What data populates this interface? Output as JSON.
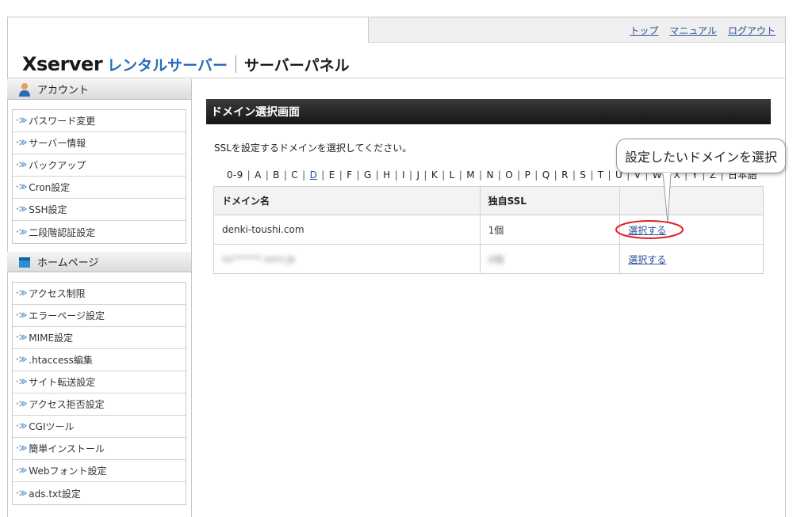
{
  "header": {
    "logo_xserver": "Xserver",
    "logo_rental": "レンタルサーバー",
    "logo_panel": "サーバーパネル",
    "nav": [
      "トップ",
      "マニュアル",
      "ログアウト"
    ]
  },
  "sidebar": {
    "account_title": "アカウント",
    "account_items": [
      "パスワード変更",
      "サーバー情報",
      "バックアップ",
      "Cron設定",
      "SSH設定",
      "二段階認証設定"
    ],
    "homepage_title": "ホームページ",
    "homepage_items": [
      "アクセス制限",
      "エラーページ設定",
      "MIME設定",
      ".htaccess編集",
      "サイト転送設定",
      "アクセス拒否設定",
      "CGIツール",
      "簡単インストール",
      "Webフォント設定",
      "ads.txt設定"
    ]
  },
  "main": {
    "title": "ドメイン選択画面",
    "instruction": "SSLを設定するドメインを選択してください。",
    "alpha_index": [
      "0-9",
      "A",
      "B",
      "C",
      "D",
      "E",
      "F",
      "G",
      "H",
      "I",
      "J",
      "K",
      "L",
      "M",
      "N",
      "O",
      "P",
      "Q",
      "R",
      "S",
      "T",
      "U",
      "V",
      "W",
      "X",
      "Y",
      "Z",
      "日本語"
    ],
    "alpha_current": "D",
    "table": {
      "headers": [
        "ドメイン名",
        "独自SSL",
        ""
      ],
      "rows": [
        {
          "domain": "denki-toushi.com",
          "ssl": "1個",
          "action": "選択する"
        },
        {
          "domain": "xs******.xsrv.jp",
          "ssl": "0個",
          "action": "選択する"
        }
      ]
    }
  },
  "callout": {
    "text": "設定したいドメインを選択"
  },
  "colors": {
    "link": "#2a4f9a",
    "highlight": "#e02020",
    "title_bar": "#1e1e1e"
  }
}
